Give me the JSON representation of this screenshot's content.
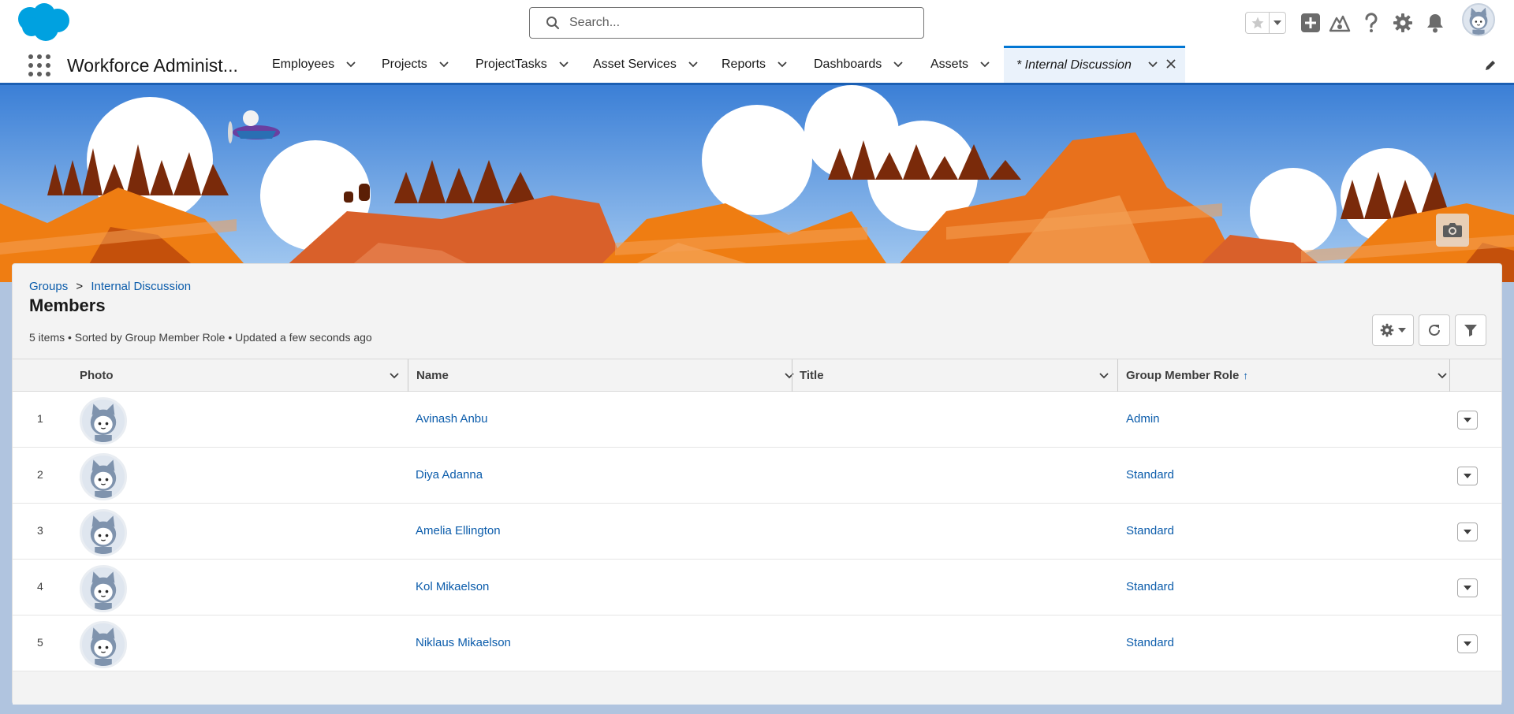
{
  "header": {
    "search_placeholder": "Search...",
    "icons": [
      "salesforce-cloud-logo",
      "search-icon",
      "favorite-star-icon",
      "caret-down-icon",
      "add-icon",
      "trailhead-icon",
      "help-icon",
      "setup-gear-icon",
      "notifications-bell-icon",
      "user-avatar"
    ]
  },
  "nav": {
    "app_name": "Workforce Administ...",
    "items": [
      {
        "label": "Employees"
      },
      {
        "label": "Projects"
      },
      {
        "label": "ProjectTasks"
      },
      {
        "label": "Asset Services"
      },
      {
        "label": "Reports"
      },
      {
        "label": "Dashboards"
      },
      {
        "label": "Assets"
      }
    ],
    "active_tab": "* Internal Discussion"
  },
  "card": {
    "breadcrumb": {
      "parent": "Groups",
      "separator": ">",
      "current": "Internal Discussion"
    },
    "title": "Members",
    "list_info": "5 items • Sorted by Group Member Role • Updated a few seconds ago"
  },
  "table": {
    "columns": [
      {
        "label": "Photo"
      },
      {
        "label": "Name"
      },
      {
        "label": "Title"
      },
      {
        "label": "Group Member Role"
      }
    ],
    "sort_indicator": "↑",
    "rows": [
      {
        "num": "1",
        "name": "Avinash Anbu",
        "title": "",
        "role": "Admin"
      },
      {
        "num": "2",
        "name": "Diya Adanna",
        "title": "",
        "role": "Standard"
      },
      {
        "num": "3",
        "name": "Amelia Ellington",
        "title": "",
        "role": "Standard"
      },
      {
        "num": "4",
        "name": "Kol Mikaelson",
        "title": "",
        "role": "Standard"
      },
      {
        "num": "5",
        "name": "Niklaus Mikaelson",
        "title": "",
        "role": "Standard"
      }
    ]
  },
  "colors": {
    "brand_blue": "#0176d3",
    "link_blue": "#0b5cab",
    "banner_orange": "#e8711c",
    "banner_sky": "#5b95dd"
  }
}
